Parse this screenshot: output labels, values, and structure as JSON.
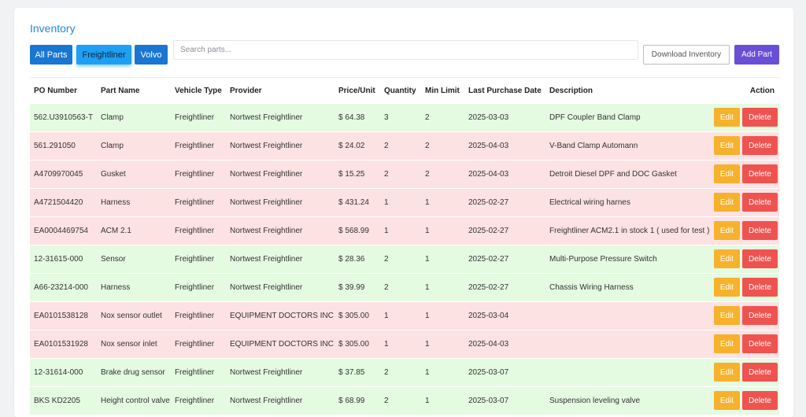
{
  "header": {
    "title": "Inventory",
    "filters": [
      "All Parts",
      "Freightliner",
      "Volvo"
    ],
    "search_placeholder": "Search parts...",
    "download_label": "Download Inventory",
    "add_label": "Add Part"
  },
  "colors": {
    "title": "#1e88e5",
    "filter_button": "#1976d2",
    "filter_active": "#1e9ff2",
    "add_button": "#6a4fd6",
    "edit_button": "#f6b22c",
    "delete_button": "#ef5350",
    "row_green": "#e4fbe1",
    "row_red": "#fde2e3"
  },
  "table": {
    "columns": [
      "PO Number",
      "Part Name",
      "Vehicle Type",
      "Provider",
      "Price/Unit",
      "Quantity",
      "Min Limit",
      "Last Purchase Date",
      "Description",
      "Action"
    ],
    "edit_label": "Edit",
    "delete_label": "Delete",
    "rows": [
      {
        "po": "562.U3910563-T",
        "part": "Clamp",
        "vehicle": "Freightliner",
        "provider": "Nortwest Freightliner",
        "price": "$ 64.38",
        "qty": "3",
        "min": "2",
        "date": "2025-03-03",
        "desc": "DPF Coupler Band Clamp",
        "status": "green"
      },
      {
        "po": "561.291050",
        "part": "Clamp",
        "vehicle": "Freightliner",
        "provider": "Nortwest Freightliner",
        "price": "$ 24.02",
        "qty": "2",
        "min": "2",
        "date": "2025-04-03",
        "desc": "V-Band Clamp Automann",
        "status": "red"
      },
      {
        "po": "A4709970045",
        "part": "Gusket",
        "vehicle": "Freightliner",
        "provider": "Nortwest Freightliner",
        "price": "$ 15.25",
        "qty": "2",
        "min": "2",
        "date": "2025-04-03",
        "desc": "Detroit Diesel DPF and DOC Gasket",
        "status": "red"
      },
      {
        "po": "A4721504420",
        "part": "Harness",
        "vehicle": "Freightliner",
        "provider": "Nortwest Freightliner",
        "price": "$ 431.24",
        "qty": "1",
        "min": "1",
        "date": "2025-02-27",
        "desc": "Electrical wiring harnes",
        "status": "red"
      },
      {
        "po": "EA0004469754",
        "part": "ACM 2.1",
        "vehicle": "Freightliner",
        "provider": "Nortwest Freightliner",
        "price": "$ 568.99",
        "qty": "1",
        "min": "1",
        "date": "2025-02-27",
        "desc": "Freightliner ACM2.1 in stock 1 ( used for test )",
        "status": "red"
      },
      {
        "po": "12-31615-000",
        "part": "Sensor",
        "vehicle": "Freightliner",
        "provider": "Nortwest Freightliner",
        "price": "$ 28.36",
        "qty": "2",
        "min": "1",
        "date": "2025-02-27",
        "desc": "Multi-Purpose Pressure Switch",
        "status": "green"
      },
      {
        "po": "A66-23214-000",
        "part": "Harness",
        "vehicle": "Freightliner",
        "provider": "Nortwest Freightliner",
        "price": "$ 39.99",
        "qty": "2",
        "min": "1",
        "date": "2025-02-27",
        "desc": "Chassis Wiring Harness",
        "status": "green"
      },
      {
        "po": "EA0101538128",
        "part": "Nox sensor outlet",
        "vehicle": "Freightliner",
        "provider": "EQUIPMENT DOCTORS INC",
        "price": "$ 305.00",
        "qty": "1",
        "min": "1",
        "date": "2025-03-04",
        "desc": "",
        "status": "red"
      },
      {
        "po": "EA0101531928",
        "part": "Nox sensor inlet",
        "vehicle": "Freightliner",
        "provider": "EQUIPMENT DOCTORS INC",
        "price": "$ 305.00",
        "qty": "1",
        "min": "1",
        "date": "2025-04-03",
        "desc": "",
        "status": "red"
      },
      {
        "po": "12-31614-000",
        "part": "Brake drug sensor",
        "vehicle": "Freightliner",
        "provider": "Nortwest Freightliner",
        "price": "$ 37.85",
        "qty": "2",
        "min": "1",
        "date": "2025-03-07",
        "desc": "",
        "status": "green"
      },
      {
        "po": "BKS KD2205",
        "part": "Height control valve",
        "vehicle": "Freightliner",
        "provider": "Nortwest Freightliner",
        "price": "$ 68.99",
        "qty": "2",
        "min": "1",
        "date": "2025-03-07",
        "desc": "Suspension leveling valve",
        "status": "green"
      }
    ]
  }
}
